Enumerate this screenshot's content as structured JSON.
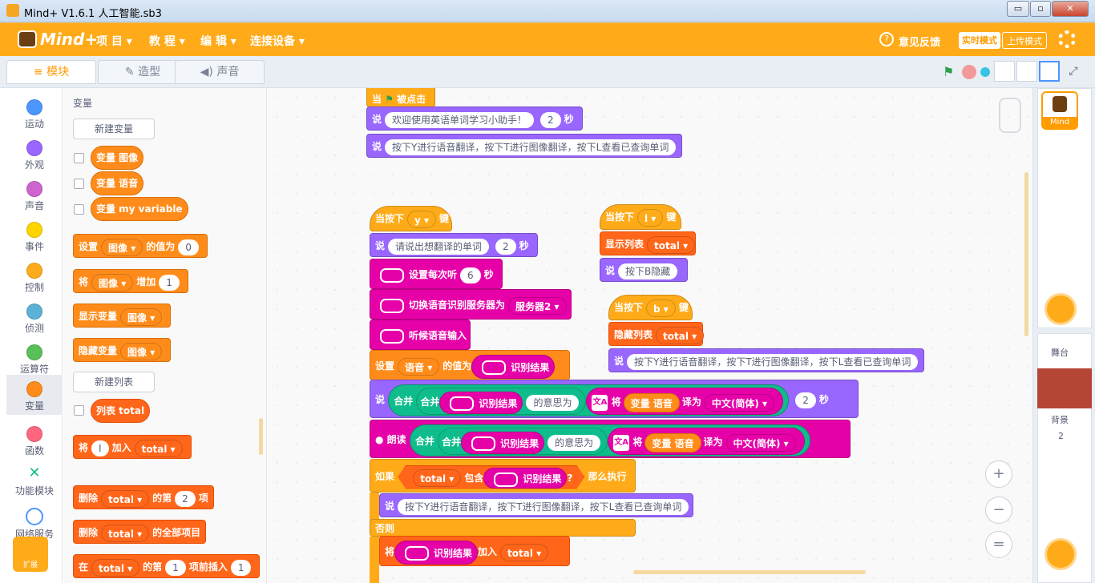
{
  "window": {
    "title": "Mind+ V1.6.1      人工智能.sb3",
    "minimize": "▭",
    "restore": "▫",
    "close": "✕"
  },
  "menubar": {
    "brand": "Mind+",
    "items": [
      "项 目 ▾",
      "教 程 ▾",
      "编 辑 ▾",
      "连接设备 ▾"
    ],
    "feedback": "意见反馈",
    "mode_realtime": "实时模式",
    "mode_upload": "上传模式",
    "settings_icon": "gear-icon"
  },
  "tabs": [
    {
      "label": "模块",
      "icon": "blocks-icon"
    },
    {
      "label": "造型",
      "icon": "brush-icon"
    },
    {
      "label": "声音",
      "icon": "speaker-icon"
    }
  ],
  "categories": [
    {
      "label": "运动",
      "color": "#4c97ff"
    },
    {
      "label": "外观",
      "color": "#9966ff"
    },
    {
      "label": "声音",
      "color": "#cf63cf"
    },
    {
      "label": "事件",
      "color": "#ffd500"
    },
    {
      "label": "控制",
      "color": "#ffab19"
    },
    {
      "label": "侦测",
      "color": "#5cb1d6"
    },
    {
      "label": "运算符",
      "color": "#59c059"
    },
    {
      "label": "变量",
      "color": "#ff8c1a"
    },
    {
      "label": "函数",
      "color": "#ff6680"
    },
    {
      "label": "功能模块",
      "color": "#0fbd8c"
    },
    {
      "label": "网络服务",
      "color": "#4c97ff"
    },
    {
      "label": "扩展",
      "color": "#ffab19"
    }
  ],
  "palette": {
    "heading": "变量",
    "new_variable": "新建变量",
    "variables": [
      "变量 图像",
      "变量 语音",
      "变量 my variable"
    ],
    "blocks": {
      "set": {
        "a": "设置",
        "dd": "图像 ▾",
        "b": "的值为",
        "v": "0"
      },
      "change": {
        "a": "将",
        "dd": "图像 ▾",
        "b": "增加",
        "v": "1"
      },
      "show": {
        "a": "显示变量",
        "dd": "图像 ▾"
      },
      "hide": {
        "a": "隐藏变量",
        "dd": "图像 ▾"
      }
    },
    "new_list": "新建列表",
    "list": "列表 total",
    "list_blocks": {
      "add": {
        "a": "将",
        "v": "I",
        "b": "加入",
        "dd": "total ▾"
      },
      "delete": {
        "a": "删除",
        "dd": "total ▾",
        "b": "的第",
        "v": "2",
        "c": "项"
      },
      "delete_all": {
        "a": "删除",
        "dd": "total ▾",
        "b": "的全部项目"
      },
      "insert": {
        "a": "在",
        "dd": "total ▾",
        "b": "的第",
        "v": "1",
        "c": "项前插入",
        "v2": "1"
      }
    }
  },
  "script": {
    "flag": {
      "a": "当",
      "b": "被点击"
    },
    "say1": {
      "a": "说",
      "text": "欢迎使用英语单词学习小助手！",
      "secs": "2",
      "unit": "秒"
    },
    "say2": {
      "a": "说",
      "text": "按下Y进行语音翻译，按下T进行图像翻译，按下L查看已查询单词"
    },
    "key_y": {
      "a": "当按下",
      "dd": "y ▾",
      "b": "键"
    },
    "say3": {
      "a": "说",
      "text": "请说出想翻译的单词",
      "secs": "2",
      "unit": "秒"
    },
    "listen_time": {
      "a": "设置每次听",
      "v": "6",
      "unit": "秒"
    },
    "switch_server": {
      "a": "切换语音识别服务器为",
      "dd": "服务器2 ▾"
    },
    "listen": {
      "a": "听候语音输入"
    },
    "set_voice": {
      "a": "设置",
      "dd": "语音 ▾",
      "b": "的值为",
      "c": "识别结果"
    },
    "say_join": {
      "a": "说",
      "j1": "合并",
      "j2": "合并",
      "r": "识别结果",
      "m": "的意思为",
      "t": "将",
      "var": "变量 语音",
      "to": "译为",
      "lang": "中文(简体) ▾",
      "secs": "2",
      "unit": "秒"
    },
    "speak": {
      "a": "朗读",
      "j1": "合并",
      "j2": "合并",
      "r": "识别结果",
      "m": "的意思为",
      "t": "将",
      "var": "变量 语音",
      "to": "译为",
      "lang": "中文(简体) ▾"
    },
    "if": {
      "a": "如果",
      "dd": "total ▾",
      "b": "包含",
      "r": "识别结果",
      "q": "?",
      "c": "那么执行"
    },
    "if_say": {
      "a": "说",
      "text": "按下Y进行语音翻译，按下T进行图像翻译，按下L查看已查询单词"
    },
    "else": "否则",
    "add": {
      "a": "将",
      "r": "识别结果",
      "b": "加入",
      "dd": "total ▾"
    },
    "key_l": {
      "a": "当按下",
      "dd": "l ▾",
      "b": "键"
    },
    "show_list": {
      "a": "显示列表",
      "dd": "total ▾"
    },
    "say_b": {
      "a": "说",
      "text": "按下B隐藏"
    },
    "key_b": {
      "a": "当按下",
      "dd": "b ▾",
      "b": "键"
    },
    "hide_list": {
      "a": "隐藏列表",
      "dd": "total ▾"
    },
    "say_b2": {
      "a": "说",
      "text": "按下Y进行语音翻译，按下T进行图像翻译，按下L查看已查询单词"
    }
  },
  "right": {
    "sprite_name": "Mind",
    "stage_label": "舞台",
    "backdrop_label": "背景",
    "backdrop_count": "2"
  },
  "zoom": {
    "in": "+",
    "out": "−",
    "reset": "="
  }
}
